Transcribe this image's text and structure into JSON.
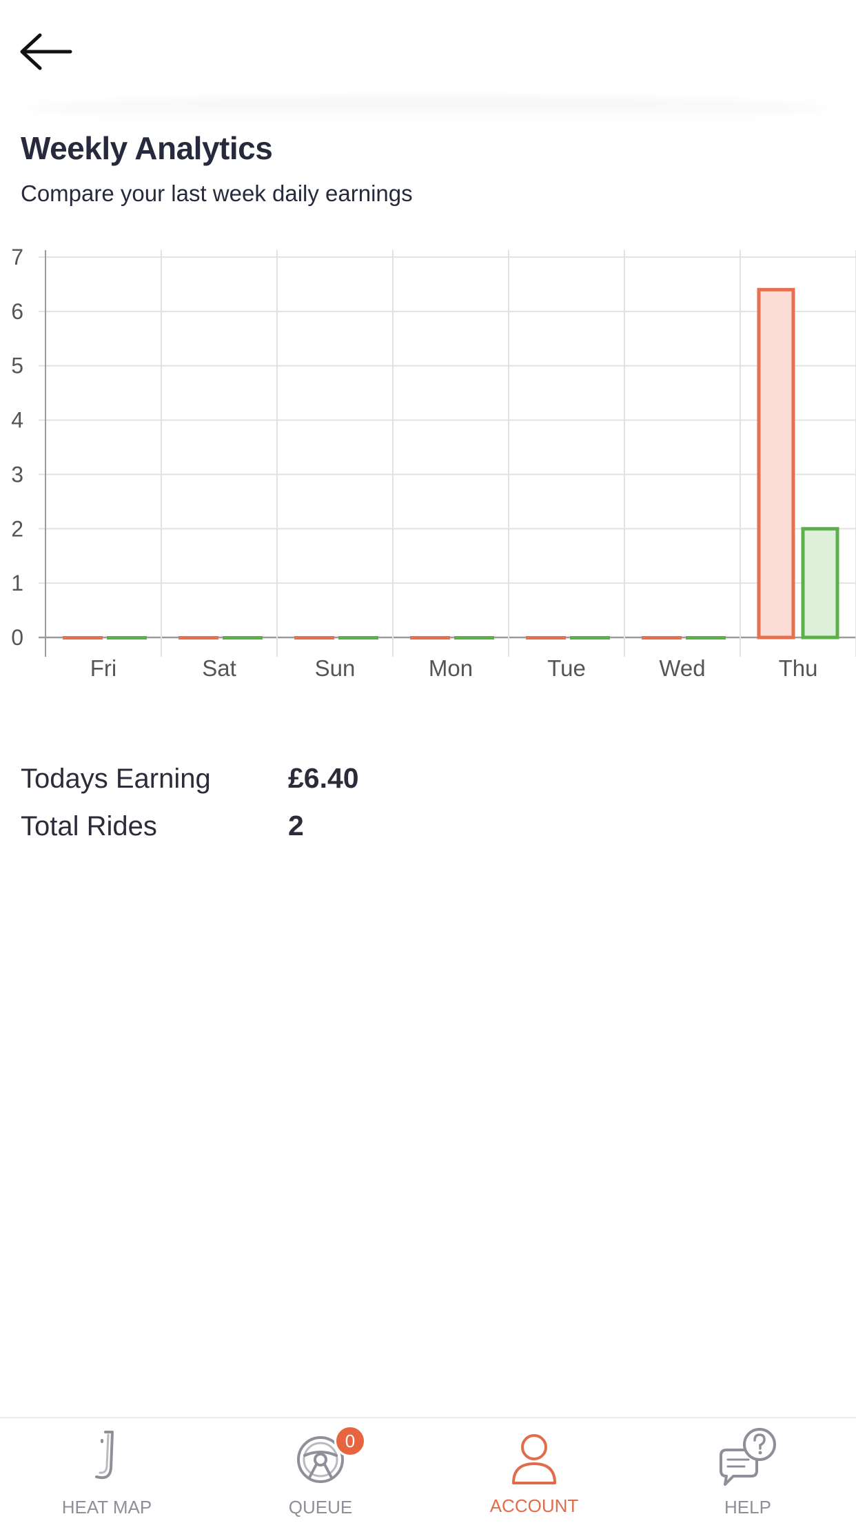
{
  "header": {
    "title": "Weekly Analytics",
    "subtitle": "Compare your last week daily earnings"
  },
  "colors": {
    "earnings": "#e4704f",
    "earnings_fill": "#fbdcd6",
    "rides": "#5bb04a",
    "rides_fill": "#def0da",
    "accent": "#e06c4c"
  },
  "chart_data": {
    "type": "bar",
    "categories": [
      "Fri",
      "Sat",
      "Sun",
      "Mon",
      "Tue",
      "Wed",
      "Thu"
    ],
    "series": [
      {
        "values": [
          0,
          0,
          0,
          0,
          0,
          0,
          6.4
        ]
      },
      {
        "values": [
          0,
          0,
          0,
          0,
          0,
          0,
          2
        ]
      }
    ],
    "ylim": [
      0,
      7
    ],
    "yticks": [
      0,
      1,
      2,
      3,
      4,
      5,
      6,
      7
    ],
    "grid": true,
    "legend": "none"
  },
  "stats": {
    "earning_label": "Todays Earning",
    "earning_value": "£6.40",
    "rides_label": "Total Rides",
    "rides_value": "2"
  },
  "nav": {
    "items": [
      {
        "label": "HEAT MAP",
        "icon": "heat-map-icon",
        "active": false
      },
      {
        "label": "QUEUE",
        "icon": "steering-wheel-icon",
        "active": false,
        "badge": "0"
      },
      {
        "label": "ACCOUNT",
        "icon": "person-icon",
        "active": true
      },
      {
        "label": "HELP",
        "icon": "help-chat-icon",
        "active": false
      }
    ]
  }
}
